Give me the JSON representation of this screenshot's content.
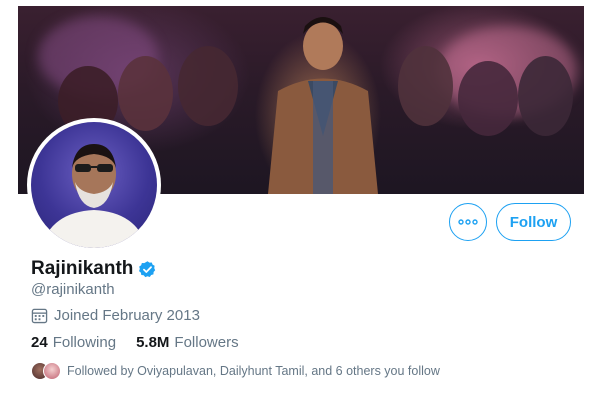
{
  "profile": {
    "display_name": "Rajinikanth",
    "handle": "@rajinikanth",
    "verified": true,
    "joined": "Joined February 2013",
    "following_count": "24",
    "following_label": "Following",
    "followers_count": "5.8M",
    "followers_label": "Followers",
    "followed_by": "Followed by Oviyapulavan, Dailyhunt Tamil, and 6 others you follow"
  },
  "actions": {
    "follow_label": "Follow",
    "more_icon": "more-horizontal-icon"
  },
  "colors": {
    "accent": "#1da1f2",
    "text_primary": "#14171a",
    "text_secondary": "#657786"
  }
}
